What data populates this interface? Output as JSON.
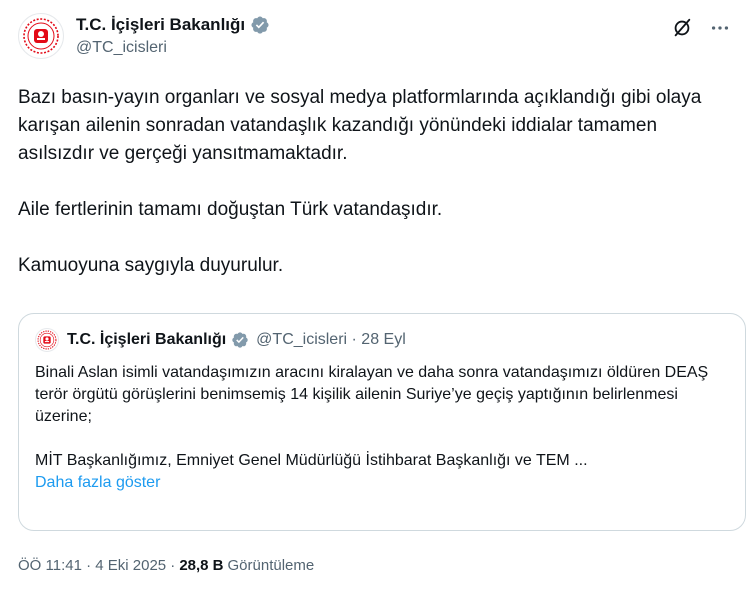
{
  "author": {
    "display_name": "T.C. İçişleri Bakanlığı",
    "handle": "@TC_icisleri",
    "verified": true,
    "verified_color": "#829aab"
  },
  "body": {
    "paragraphs": [
      "Bazı basın-yayın organları ve sosyal medya platformlarında açıklandığı gibi olaya karışan ailenin sonradan vatandaşlık kazandığı yönündeki iddialar tamamen asılsızdır ve gerçeği yansıtmamaktadır.",
      "Aile fertlerinin tamamı doğuştan Türk vatandaşıdır.",
      "Kamuoyuna saygıyla duyurulur."
    ]
  },
  "quote": {
    "display_name": "T.C. İçişleri Bakanlığı",
    "meta": "@TC_icisleri · 28 Eyl",
    "paragraphs": [
      "Binali Aslan isimli vatandaşımızın aracını kiralayan ve daha sonra vatandaşımızı öldüren DEAŞ terör örgütü görüşlerini benimsemiş 14 kişilik ailenin Suriye’ye geçiş yaptığının belirlenmesi üzerine;",
      "MİT Başkanlığımız, Emniyet Genel Müdürlüğü İstihbarat Başkanlığı ve TEM ..."
    ],
    "show_more": "Daha fazla göster"
  },
  "footer": {
    "time_date": "ÖÖ 11:41 · 4 Eki 2025 ·",
    "views_count": "28,8 B",
    "views_label": "Görüntüleme"
  },
  "icons": {
    "grok": "grok-icon",
    "more": "more-icon",
    "verified": "verified-badge-icon",
    "logo": "ministry-emblem-icon"
  },
  "colors": {
    "text": "#0f1419",
    "secondary": "#536471",
    "link": "#1d9bf0",
    "border": "#cfd9de",
    "emblem_red": "#e30a17"
  }
}
